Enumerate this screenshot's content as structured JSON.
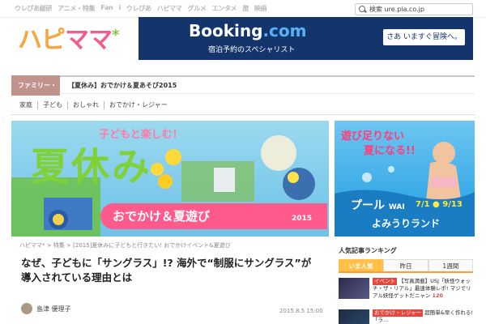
{
  "nav": {
    "links": [
      "ウレぴあ総研",
      "アニメ・特集",
      "Fan",
      "i",
      "ウレぴあ",
      "ハピママ",
      "グルメ",
      "エンタメ",
      "旅",
      "映画"
    ],
    "search_placeholder": "検索 ure.pia.co.jp"
  },
  "header": {
    "logo_text": "ハピ",
    "logo_text_2": "ママ",
    "logo_star": "*"
  },
  "booking_ad": {
    "brand": "Booking",
    "brand_suffix": ".com",
    "subtitle": "宿泊予約のスペシャリスト",
    "cta": "さあ いますぐ冒険へ。"
  },
  "category_bar": {
    "tab": "ファミリー・",
    "title": "【夏休み】おでかけ＆夏あそび2015"
  },
  "subnav": [
    "家庭",
    "子ども",
    "おしゃれ",
    "おでかけ・レジャー"
  ],
  "hero": {
    "tagline": "子どもと楽しむ！",
    "title": "夏休み",
    "subtitle": "おでかけ＆夏遊び",
    "year": "2015"
  },
  "pool_ad": {
    "line1": "遊び足りない",
    "line2": "夏になる!!",
    "name": "プール",
    "name_suffix": "WAI",
    "dates": "7/1 ● 9/13",
    "brand": "よみうりランド"
  },
  "article": {
    "breadcrumb": "ハピママ* > 特集 > [2015]夏休みに子どもと行きたい! おでかけイベント&夏遊び",
    "headline": "なぜ、子どもに「サングラス」!? 海外で“制服にサングラス”が導入されている理由とは",
    "author": "島津 優理子",
    "date": "2015.8.5 15:00"
  },
  "ranking": {
    "title": "人気記事ランキング",
    "tabs": [
      "いま人気",
      "昨日",
      "1週間"
    ],
    "items": [
      {
        "tag": "イベント",
        "text": "【写真満載】USJ「妖怪ウォッチ・ザ・リアル」最速体験レポ! マジでリアル妖怪ゲットだニャン",
        "count": "120"
      },
      {
        "tag": "おでかけ・レジャー",
        "text": "超簡単&早く作れる!「ラ…"
      }
    ]
  },
  "colors": {
    "booking_bg": "#13356b",
    "category_tab": "#c2938c",
    "rank_active": "#ffbf48",
    "hero_pink": "#ff5a8c",
    "hero_green": "#7fd137"
  }
}
